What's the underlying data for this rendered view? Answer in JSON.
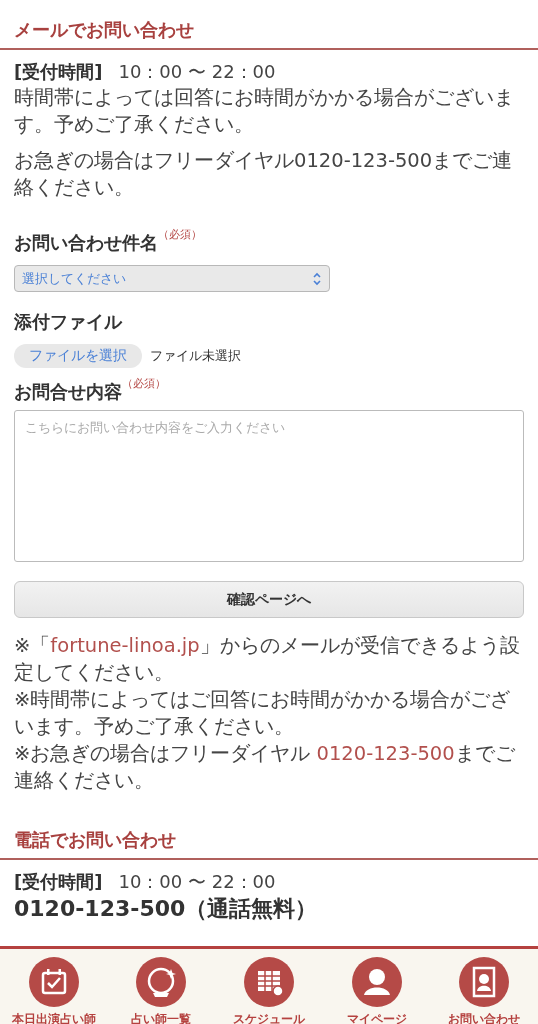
{
  "mail_section": {
    "heading": "メールでお問い合わせ",
    "hours": {
      "label": "[受付時間]",
      "value": "10：00 〜 22：00"
    },
    "paragraphs": [
      "時間帯によっては回答にお時間がかかる場合がございます。予めご了承ください。",
      "お急ぎの場合はフリーダイヤル0120-123-500までご連絡ください。"
    ],
    "form": {
      "subject": {
        "label": "お問い合わせ件名",
        "required": "（必須）",
        "placeholder": "選択してください"
      },
      "attachment": {
        "label": "添付ファイル",
        "button": "ファイルを選択",
        "status": "ファイル未選択"
      },
      "content": {
        "label": "お問合せ内容",
        "required": "（必須）",
        "placeholder": "こちらにお問い合わせ内容をご入力ください"
      },
      "submit": "確認ページへ"
    },
    "notes": [
      [
        {
          "kind": "text",
          "text": "※「"
        },
        {
          "kind": "link",
          "text": "fortune-linoa.jp"
        },
        {
          "kind": "text",
          "text": "」からのメールが受信できるよう設定してください。"
        }
      ],
      [
        {
          "kind": "text",
          "text": "※時間帯によってはご回答にお時間がかかる場合がございます。予めご了承ください。"
        }
      ],
      [
        {
          "kind": "text",
          "text": "※お急ぎの場合はフリーダイヤル "
        },
        {
          "kind": "link",
          "text": "0120-123-500"
        },
        {
          "kind": "text",
          "text": "までご連絡ください。"
        }
      ]
    ]
  },
  "phone_section": {
    "heading": "電話でお問い合わせ",
    "hours": {
      "label": "[受付時間]",
      "value": "10：00 〜 22：00"
    },
    "phone": "0120-123-500（通話無料）"
  },
  "tab_bar": [
    {
      "kind": "calendar",
      "label": "本日出演占い師"
    },
    {
      "kind": "crystal",
      "label": "占い師一覧"
    },
    {
      "kind": "schedule",
      "label": "スケジュール"
    },
    {
      "kind": "person",
      "label": "マイページ"
    },
    {
      "kind": "contact",
      "label": "お問い合わせ"
    }
  ]
}
